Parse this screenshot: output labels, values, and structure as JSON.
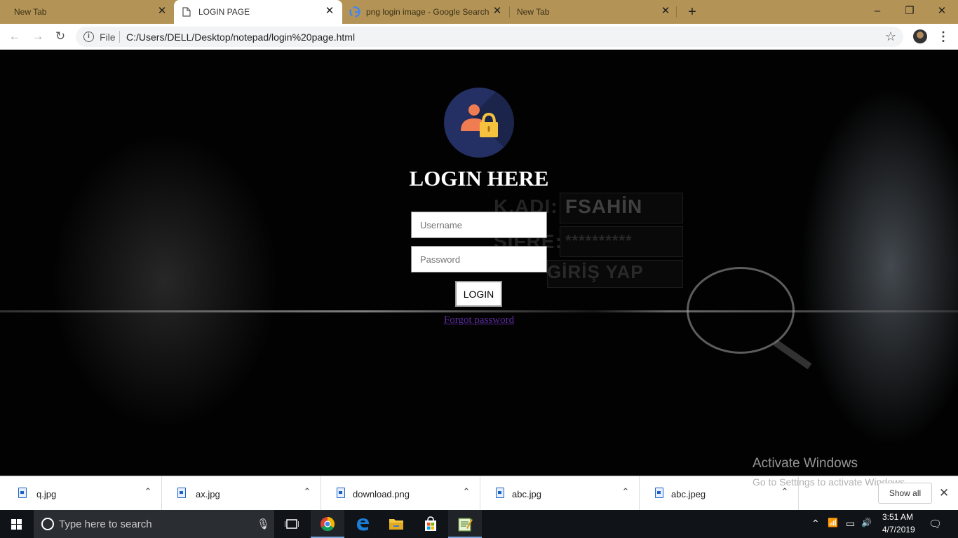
{
  "browser": {
    "tabs": [
      {
        "title": "New Tab",
        "active": false
      },
      {
        "title": "LOGIN PAGE",
        "active": true
      },
      {
        "title": "png login image - Google Search",
        "active": false
      },
      {
        "title": "New Tab",
        "active": false
      }
    ],
    "new_tab_label": "+",
    "window_controls": {
      "minimize": "–",
      "restore": "❐",
      "close": "✕"
    },
    "nav": {
      "back": "←",
      "forward": "→",
      "reload": "↻"
    },
    "omnibox": {
      "info_glyph": "i",
      "scheme_label": "File",
      "url": "C:/Users/DELL/Desktop/notepad/login%20page.html"
    },
    "star_glyph": "☆",
    "menu_glyph": "⋮"
  },
  "page": {
    "background_text": {
      "username_label": "K.ADI:",
      "username_value": "FSAHİN",
      "password_label": "ŞİFRE:",
      "password_value": "**********",
      "submit_label": "GİRİŞ YAP"
    },
    "heading": "LOGIN HERE",
    "username_placeholder": "Username",
    "password_placeholder": "Password",
    "login_button": "LOGIN",
    "forgot_link": "Forgot password",
    "watermark": {
      "title": "Activate Windows",
      "subtitle": "Go to Settings to activate Windows."
    }
  },
  "downloads": {
    "items": [
      {
        "name": "q.jpg"
      },
      {
        "name": "ax.jpg"
      },
      {
        "name": "download.png"
      },
      {
        "name": "abc.jpg"
      },
      {
        "name": "abc.jpeg"
      }
    ],
    "chevron_glyph": "⌃",
    "show_all": "Show all",
    "close_glyph": "✕"
  },
  "taskbar": {
    "search_placeholder": "Type here to search",
    "mic_glyph": "🎙",
    "clock": {
      "time": "3:51 AM",
      "date": "4/7/2019"
    },
    "tray": {
      "chevron": "⌃",
      "network": "📶",
      "battery": "▭",
      "volume": "🔊",
      "notifications": "🗨"
    }
  },
  "colors": {
    "tab_strip": "#b39456",
    "logo_bg": "#243063",
    "link": "#5a2b9c",
    "person": "#f07c52",
    "lock": "#f6c23e"
  }
}
